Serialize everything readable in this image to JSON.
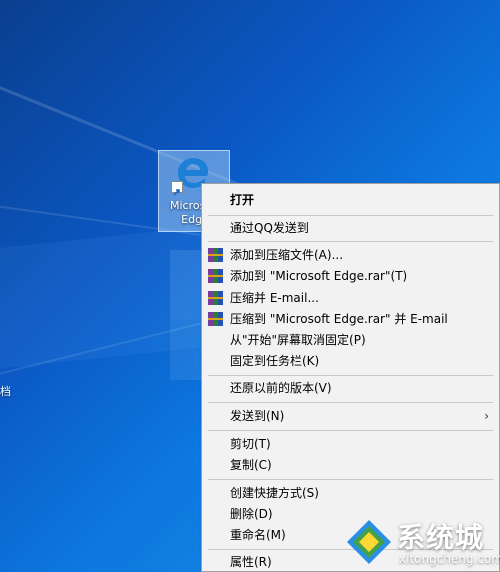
{
  "desktop": {
    "left_partial_label": "档",
    "icon": {
      "label": "Microsoft Edge",
      "icon": "edge-icon"
    }
  },
  "context_menu": {
    "items": [
      {
        "label": "打开",
        "bold": true,
        "icon": ""
      },
      {
        "label": "通过QQ发送到",
        "icon": ""
      },
      {
        "label": "添加到压缩文件(A)...",
        "icon": "winrar-icon"
      },
      {
        "label": "添加到 \"Microsoft Edge.rar\"(T)",
        "icon": "winrar-icon"
      },
      {
        "label": "压缩并 E-mail...",
        "icon": "winrar-icon"
      },
      {
        "label": "压缩到 \"Microsoft Edge.rar\" 并 E-mail",
        "icon": "winrar-icon"
      },
      {
        "label": "从\"开始\"屏幕取消固定(P)",
        "icon": ""
      },
      {
        "label": "固定到任务栏(K)",
        "icon": ""
      },
      {
        "label": "还原以前的版本(V)",
        "icon": ""
      },
      {
        "label": "发送到(N)",
        "icon": "",
        "submenu": true
      },
      {
        "label": "剪切(T)",
        "icon": ""
      },
      {
        "label": "复制(C)",
        "icon": ""
      },
      {
        "label": "创建快捷方式(S)",
        "icon": ""
      },
      {
        "label": "删除(D)",
        "icon": ""
      },
      {
        "label": "重命名(M)",
        "icon": ""
      },
      {
        "label": "属性(R)",
        "icon": ""
      }
    ],
    "submenu_arrow": "›"
  },
  "watermark": {
    "title": "系统城",
    "site": "xitongcheng.com"
  },
  "colors": {
    "menu_bg": "#f2f2f2",
    "desktop_accent": "#0b58c4",
    "edge_blue": "#1e7fd6"
  }
}
